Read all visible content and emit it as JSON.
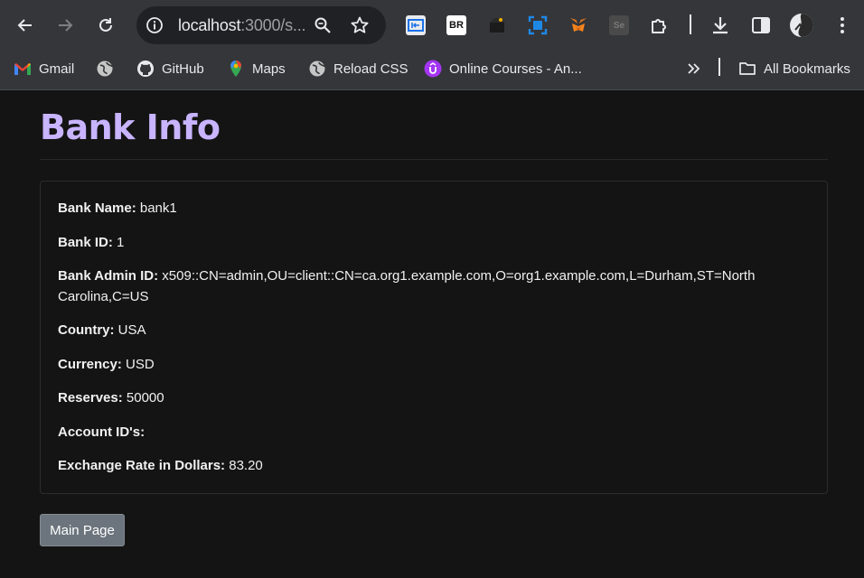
{
  "browser": {
    "url_host": "localhost",
    "url_rest": ":3000/s...",
    "bookmarks": [
      {
        "label": "Gmail"
      },
      {
        "label": ""
      },
      {
        "label": "GitHub"
      },
      {
        "label": "Maps"
      },
      {
        "label": "Reload CSS"
      },
      {
        "label": "Online Courses - An..."
      }
    ],
    "all_bookmarks": "All Bookmarks",
    "ext_br": "BR",
    "ext_se": "Se"
  },
  "page": {
    "title": "Bank Info",
    "fields": [
      {
        "label": "Bank Name:",
        "value": "bank1"
      },
      {
        "label": "Bank ID:",
        "value": "1"
      },
      {
        "label": "Bank Admin ID:",
        "value": "x509::CN=admin,OU=client::CN=ca.org1.example.com,O=org1.example.com,L=Durham,ST=North Carolina,C=US"
      },
      {
        "label": "Country:",
        "value": "USA"
      },
      {
        "label": "Currency:",
        "value": "USD"
      },
      {
        "label": "Reserves:",
        "value": "50000"
      },
      {
        "label": "Account ID's:",
        "value": ""
      },
      {
        "label": "Exchange Rate in Dollars:",
        "value": "83.20"
      }
    ],
    "main_button": "Main Page"
  },
  "colors": {
    "title": "#c8b4ff",
    "button": "#6c757d",
    "chrome": "#35363a",
    "background": "#141414"
  }
}
